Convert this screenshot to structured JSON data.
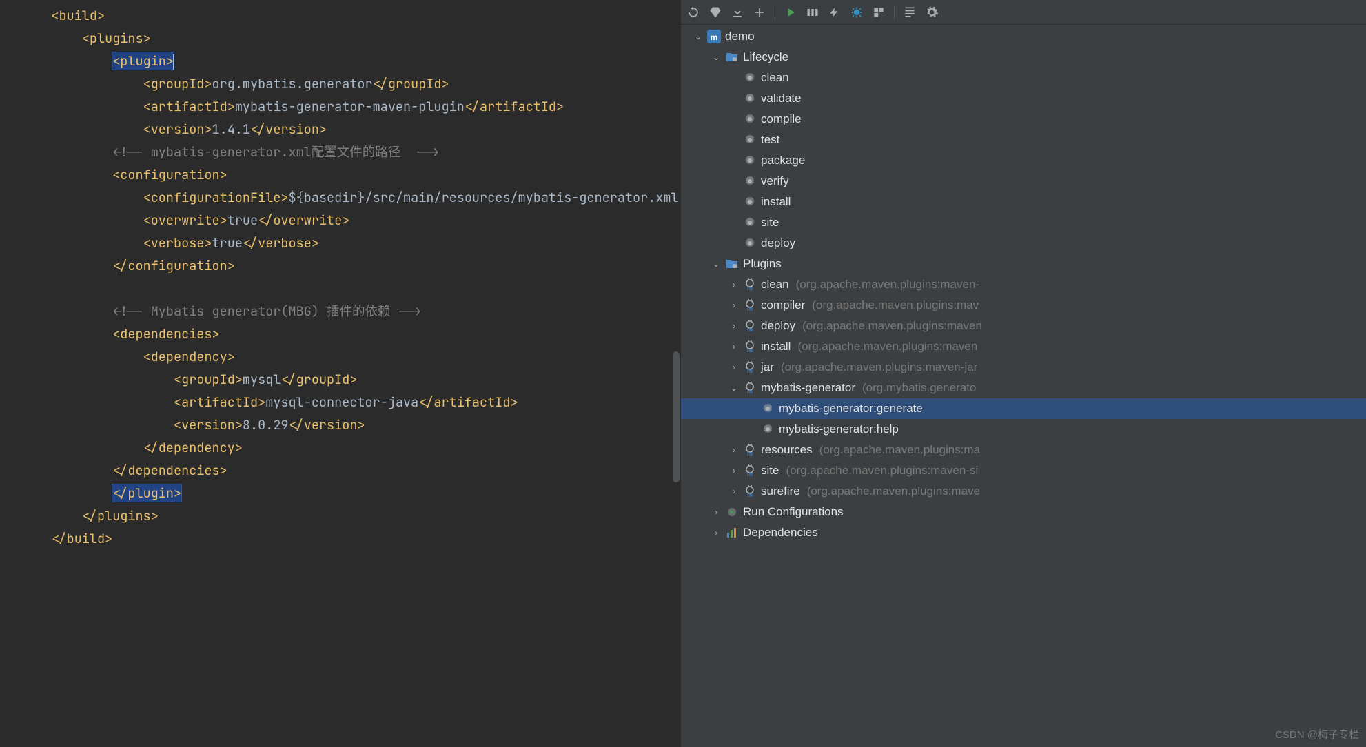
{
  "code": {
    "lines": [
      {
        "indent": 1,
        "type": "tag",
        "open": "<build>"
      },
      {
        "indent": 2,
        "type": "tag",
        "open": "<plugins>"
      },
      {
        "indent": 3,
        "type": "tag-hl",
        "open": "<plugin>",
        "cursor": true,
        "lineHighlight": true
      },
      {
        "indent": 4,
        "type": "elem",
        "open": "<groupId>",
        "text": "org.mybatis.generator",
        "close": "</groupId>"
      },
      {
        "indent": 4,
        "type": "elem",
        "open": "<artifactId>",
        "text": "mybatis-generator-maven-plugin",
        "close": "</artifactId>"
      },
      {
        "indent": 4,
        "type": "elem",
        "open": "<version>",
        "text": "1.4.1",
        "close": "</version>"
      },
      {
        "indent": 3,
        "type": "comment",
        "text": "<!-- mybatis-generator.xml配置文件的路径  -->"
      },
      {
        "indent": 3,
        "type": "tag",
        "open": "<configuration>"
      },
      {
        "indent": 4,
        "type": "elem",
        "open": "<configurationFile>",
        "text": "${basedir}/src/main/resources/mybatis-generator.xml",
        "noclose": true
      },
      {
        "indent": 4,
        "type": "elem",
        "open": "<overwrite>",
        "text": "true",
        "close": "</overwrite>"
      },
      {
        "indent": 4,
        "type": "elem",
        "open": "<verbose>",
        "text": "true",
        "close": "</verbose>"
      },
      {
        "indent": 3,
        "type": "tag",
        "open": "</configuration>"
      },
      {
        "indent": 0,
        "type": "blank"
      },
      {
        "indent": 3,
        "type": "comment",
        "text": "<!-- Mybatis generator(MBG) 插件的依赖 -->"
      },
      {
        "indent": 3,
        "type": "tag",
        "open": "<dependencies>"
      },
      {
        "indent": 4,
        "type": "tag",
        "open": "<dependency>"
      },
      {
        "indent": 5,
        "type": "elem",
        "open": "<groupId>",
        "text": "mysql",
        "close": "</groupId>"
      },
      {
        "indent": 5,
        "type": "elem",
        "open": "<artifactId>",
        "text": "mysql-connector-java",
        "close": "</artifactId>"
      },
      {
        "indent": 5,
        "type": "elem",
        "open": "<version>",
        "text": "8.0.29",
        "close": "</version>"
      },
      {
        "indent": 4,
        "type": "tag",
        "open": "</dependency>"
      },
      {
        "indent": 3,
        "type": "tag",
        "open": "</dependencies>"
      },
      {
        "indent": 3,
        "type": "tag-hl",
        "open": "</plugin>"
      },
      {
        "indent": 2,
        "type": "tag",
        "open": "</plugins>"
      },
      {
        "indent": 1,
        "type": "tag",
        "open": "</build>"
      }
    ]
  },
  "tree": {
    "root": {
      "label": "demo",
      "icon": "m",
      "expanded": true
    },
    "lifecycle": {
      "label": "Lifecycle",
      "icon": "folder-gear",
      "expanded": true,
      "items": [
        "clean",
        "validate",
        "compile",
        "test",
        "package",
        "verify",
        "install",
        "site",
        "deploy"
      ]
    },
    "pluginsHeader": {
      "label": "Plugins",
      "icon": "folder-gear",
      "expanded": true
    },
    "plugins": [
      {
        "label": "clean",
        "dim": "(org.apache.maven.plugins:maven-",
        "expanded": false
      },
      {
        "label": "compiler",
        "dim": "(org.apache.maven.plugins:mav",
        "expanded": false
      },
      {
        "label": "deploy",
        "dim": "(org.apache.maven.plugins:maven",
        "expanded": false
      },
      {
        "label": "install",
        "dim": "(org.apache.maven.plugins:maven",
        "expanded": false
      },
      {
        "label": "jar",
        "dim": "(org.apache.maven.plugins:maven-jar",
        "expanded": false
      },
      {
        "label": "mybatis-generator",
        "dim": "(org.mybatis.generato",
        "expanded": true,
        "goals": [
          "mybatis-generator:generate",
          "mybatis-generator:help"
        ],
        "selectedIndex": 0
      },
      {
        "label": "resources",
        "dim": "(org.apache.maven.plugins:ma",
        "expanded": false
      },
      {
        "label": "site",
        "dim": "(org.apache.maven.plugins:maven-si",
        "expanded": false
      },
      {
        "label": "surefire",
        "dim": "(org.apache.maven.plugins:mave",
        "expanded": false
      }
    ],
    "runConfig": {
      "label": "Run Configurations"
    },
    "deps": {
      "label": "Dependencies"
    }
  },
  "watermark": "CSDN @梅子专栏"
}
